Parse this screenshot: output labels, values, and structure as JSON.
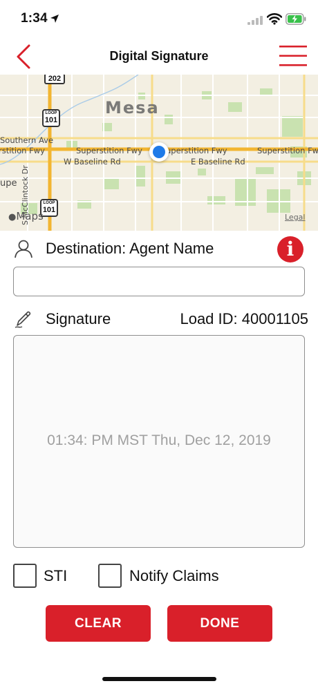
{
  "status_bar": {
    "time": "1:34"
  },
  "nav": {
    "title": "Digital Signature"
  },
  "map": {
    "city": "Mesa",
    "labels": {
      "southern_ave": "Southern Ave",
      "superstition_left": "rstition Fwy",
      "superstition_mid": "Superstition Fwy",
      "superstition_right1": "uperstition Fwy",
      "superstition_right2": "Superstition Fw",
      "w_baseline": "W Baseline Rd",
      "e_baseline": "E Baseline Rd",
      "upe": "upe",
      "mcclintock": "S McClintock Dr",
      "shield_202": "202",
      "shield_101_top": "101",
      "shield_101_bottom": "101",
      "loop": "LOOP"
    },
    "maps_logo": "Maps",
    "legal": "Legal"
  },
  "form": {
    "destination_label": "Destination: Agent Name",
    "destination_value": "",
    "info_glyph": "i",
    "signature_label": "Signature",
    "load_id": "Load ID: 40001105",
    "signature_stamp": "01:34: PM MST Thu, Dec 12, 2019",
    "checkbox_sti": "STI",
    "checkbox_notify": "Notify Claims",
    "clear_label": "CLEAR",
    "done_label": "DONE"
  },
  "colors": {
    "accent": "#d9202a",
    "location": "#1e7ae8"
  }
}
